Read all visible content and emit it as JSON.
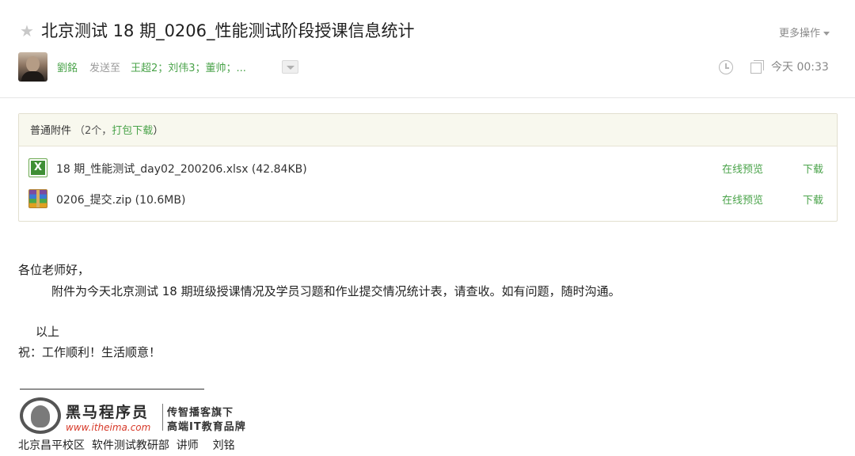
{
  "header": {
    "star_icon": "star-icon",
    "subject": "北京测试 18 期_0206_性能测试阶段授课信息统计",
    "more_actions": "更多操作",
    "sender": "劉銘",
    "sent_to_label": "发送至",
    "recipients": "王超2；刘伟3；董帅；...",
    "time": "今天 00:33"
  },
  "attachments": {
    "title": "普通附件",
    "count": "（2个，",
    "pack_download": "打包下载",
    "close_paren": "）",
    "files": [
      {
        "name": "18 期_性能测试_day02_200206.xlsx (42.84KB)",
        "icon": "excel-file-icon",
        "preview": "在线预览",
        "download": "下载"
      },
      {
        "name": "0206_提交.zip (10.6MB)",
        "icon": "zip-file-icon",
        "preview": "在线预览",
        "download": "下载"
      }
    ]
  },
  "body": {
    "greeting": "各位老师好，",
    "paragraph": "附件为今天北京测试 18 期班级授课情况及学员习题和作业提交情况统计表，请查收。如有问题，随时沟通。",
    "closing": "以上",
    "wishes": "祝：工作顺利！生活顺意！"
  },
  "signature": {
    "brand": "黑马程序员",
    "url": "www.itheima.com",
    "tagline1": "传智播客旗下",
    "tagline2": "高端IT教育品牌",
    "footer": "北京昌平校区  软件测试教研部  讲师    刘铭"
  },
  "colors": {
    "link_green": "#4aa34a",
    "attach_header_bg": "#f8f8ee",
    "url_red": "#d73a2a"
  }
}
